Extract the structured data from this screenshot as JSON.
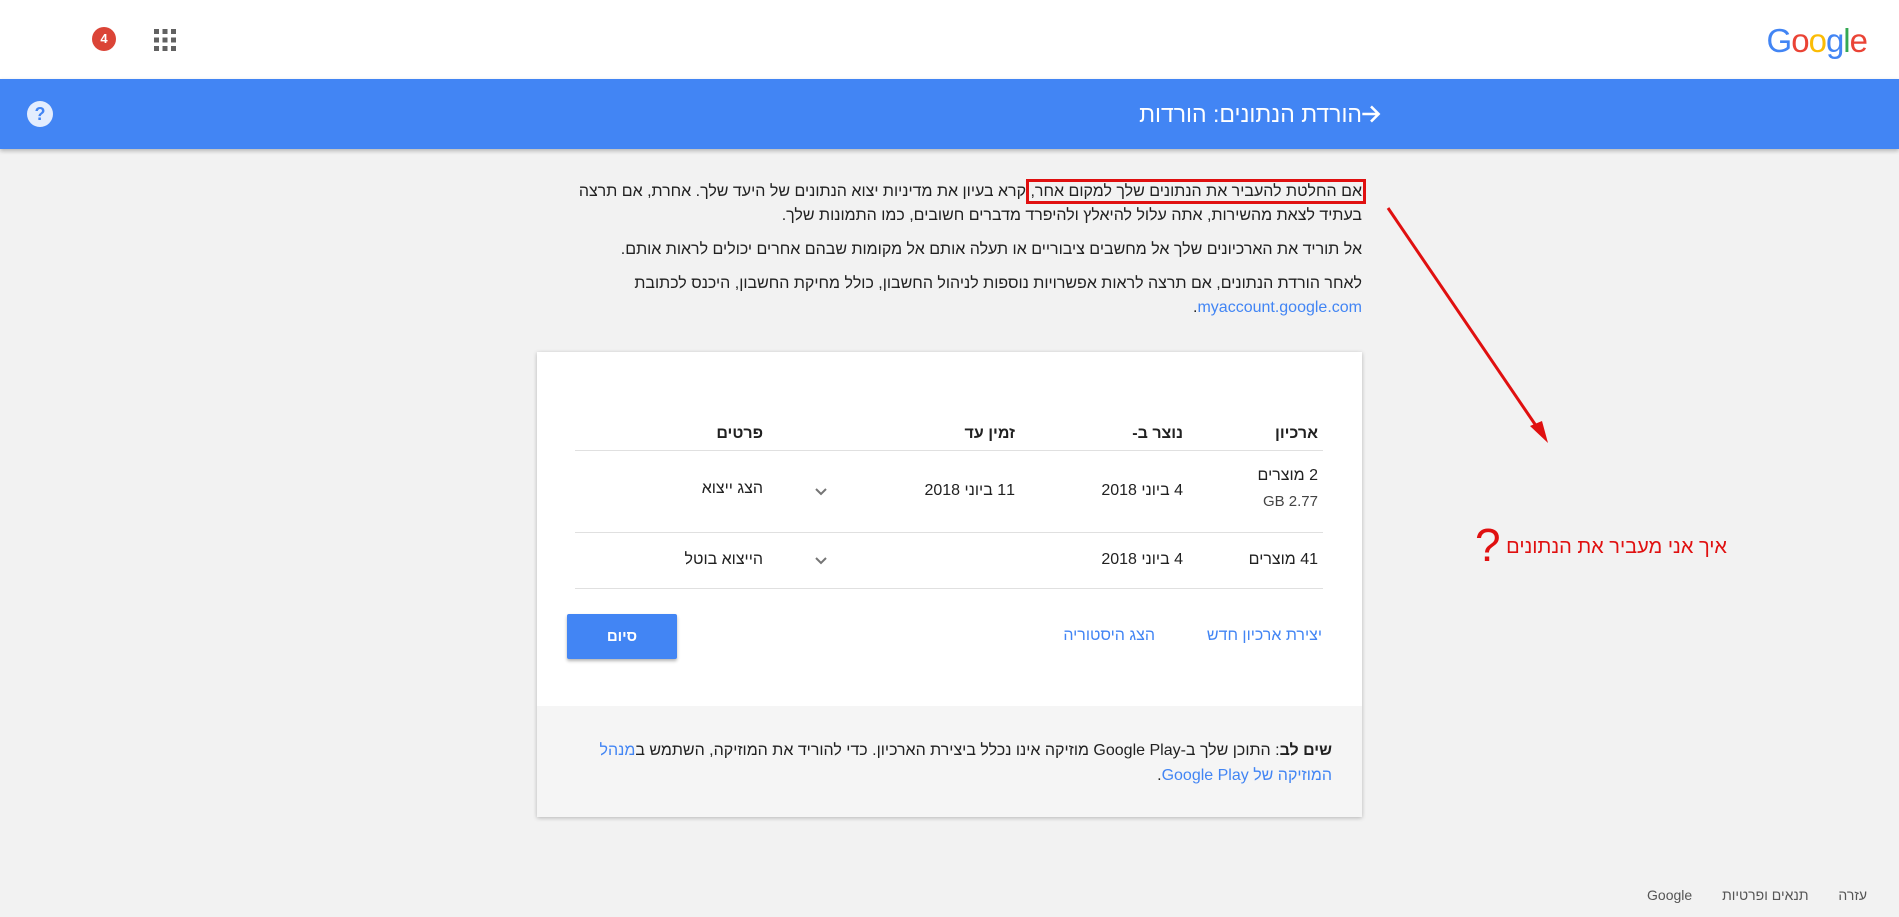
{
  "header": {
    "logo": "Google",
    "notification_count": "4",
    "title": "הורדת הנתונים: הורדות"
  },
  "intro": {
    "p1_highlight": "אם החלטת להעביר את הנתונים שלך למקום אחר,",
    "p1_rest": " קרא בעיון את מדיניות יצוא הנתונים של היעד שלך. אחרת, אם תרצה בעתיד לצאת מהשירות, אתה עלול להיאלץ ולהיפרד מדברים חשובים, כמו התמונות שלך.",
    "p2": "אל תוריד את הארכיונים שלך אל מחשבים ציבוריים או תעלה אותם אל מקומות שבהם אחרים יכולים לראות אותם.",
    "p3": "לאחר הורדת הנתונים, אם תרצה לראות אפשרויות נוספות לניהול החשבון, כולל מחיקת החשבון, היכנס לכתובת",
    "p3_link": "myaccount.google.com",
    "p3_end": "."
  },
  "table": {
    "headers": {
      "archive": "ארכיון",
      "created": "נוצר ב-",
      "until": "זמין עד",
      "details": "פרטים"
    },
    "rows": [
      {
        "products": "2 מוצרים",
        "size": "2.77 GB",
        "created": "4 ביוני 2018",
        "until": "11 ביוני 2018",
        "details": "הצג ייצוא"
      },
      {
        "products": "41 מוצרים",
        "size": "",
        "created": "4 ביוני 2018",
        "until": "",
        "details": "הייצוא בוטל"
      }
    ]
  },
  "actions": {
    "new_archive": "יצירת ארכיון חדש",
    "history": "הצג היסטוריה",
    "done": "סיום"
  },
  "note": {
    "label": "שים לב",
    "text": ": התוכן שלך ב-Google Play מוזיקה אינו נכלל ביצירת הארכיון. כדי להוריד את המוזיקה, השתמש ב",
    "link": "מנהל המוזיקה של Google Play",
    "end": "."
  },
  "annotation": {
    "text": "איך אני מעביר את הנתונים",
    "mark": "?"
  },
  "footer": {
    "google": "Google",
    "terms": "תנאים ופרטיות",
    "help": "עזרה"
  },
  "colors": {
    "brand_blue": "#4285f4",
    "badge_red": "#db4437",
    "annotation_red": "#e01010"
  }
}
